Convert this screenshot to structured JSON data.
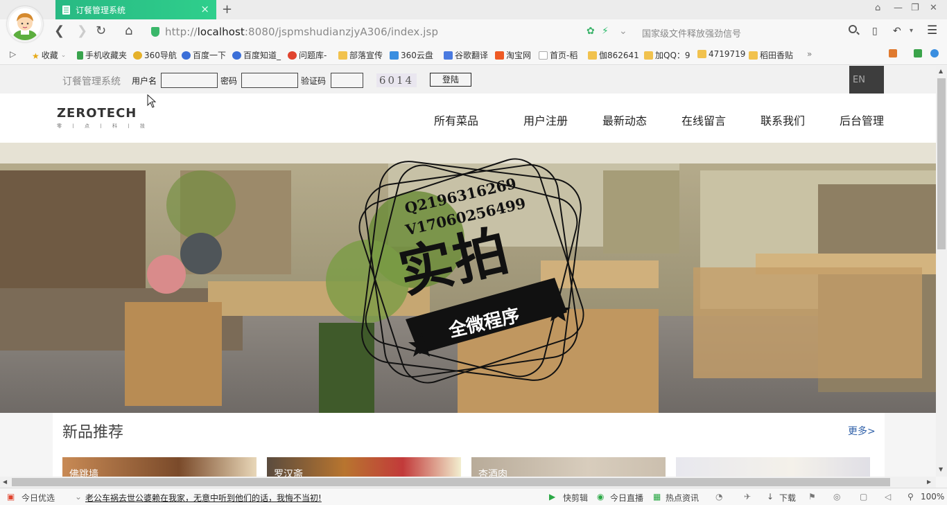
{
  "browser": {
    "tab_title": "订餐管理系统",
    "tab_close": "×",
    "new_tab": "+",
    "url_gray_prefix": "http://",
    "url_host": "localhost",
    "url_rest": ":8080/jspmshudianzjyA306/index.jsp",
    "search_placeholder": "国家级文件释放强劲信号",
    "bookmarks": [
      {
        "label": "收藏",
        "icon": "star-icon"
      },
      {
        "label": "手机收藏夹",
        "icon": "phone-icon"
      },
      {
        "label": "360导航",
        "icon": "360-icon"
      },
      {
        "label": "百度一下",
        "icon": "baidu-icon"
      },
      {
        "label": "百度知道_",
        "icon": "baidu-icon"
      },
      {
        "label": "问题库-",
        "icon": "s-icon"
      },
      {
        "label": "部落宣传",
        "icon": "folder-icon"
      },
      {
        "label": "360云盘",
        "icon": "cloud-icon"
      },
      {
        "label": "谷歌翻译",
        "icon": "translate-icon"
      },
      {
        "label": "淘宝网",
        "icon": "taobao-icon"
      },
      {
        "label": "首页-稻",
        "icon": "page-icon"
      },
      {
        "label": "伽862641",
        "icon": "folder-icon"
      },
      {
        "label": "加QQ：9",
        "icon": "folder-icon"
      },
      {
        "label": "4719719",
        "icon": "folder-icon"
      },
      {
        "label": "稻田香贴",
        "icon": "folder-icon"
      }
    ],
    "bookmarks_more": "»"
  },
  "page": {
    "login": {
      "system_name": "订餐管理系统",
      "username_label": "用户名",
      "password_label": "密码",
      "captcha_label": "验证码",
      "captcha_value": "6014",
      "login_button": "登陆",
      "lang_button": "EN"
    },
    "logo": {
      "text": "ZEROTECH",
      "sub": "零丨点丨科丨技"
    },
    "nav": [
      "所有菜品",
      "用户注册",
      "最新动态",
      "在线留言",
      "联系我们",
      "后台管理"
    ],
    "hero": {
      "qq": "Q2196316269",
      "v": "V17060256499",
      "big_text": "实拍",
      "badge_text": "全微程序"
    },
    "section": {
      "title": "新品推荐",
      "more": "更多>",
      "products": [
        "佛跳墙",
        "罗汉斋",
        "杏酒肉",
        ""
      ]
    }
  },
  "statusbar": {
    "today_pick": "今日优选",
    "news": "老公车祸去世公婆赖在我家，无意中听到他们的话，我悔不当初!",
    "quick_clip": "快剪辑",
    "live": "今日直播",
    "hot": "热点资讯",
    "download": "下载",
    "zoom": "100%"
  }
}
